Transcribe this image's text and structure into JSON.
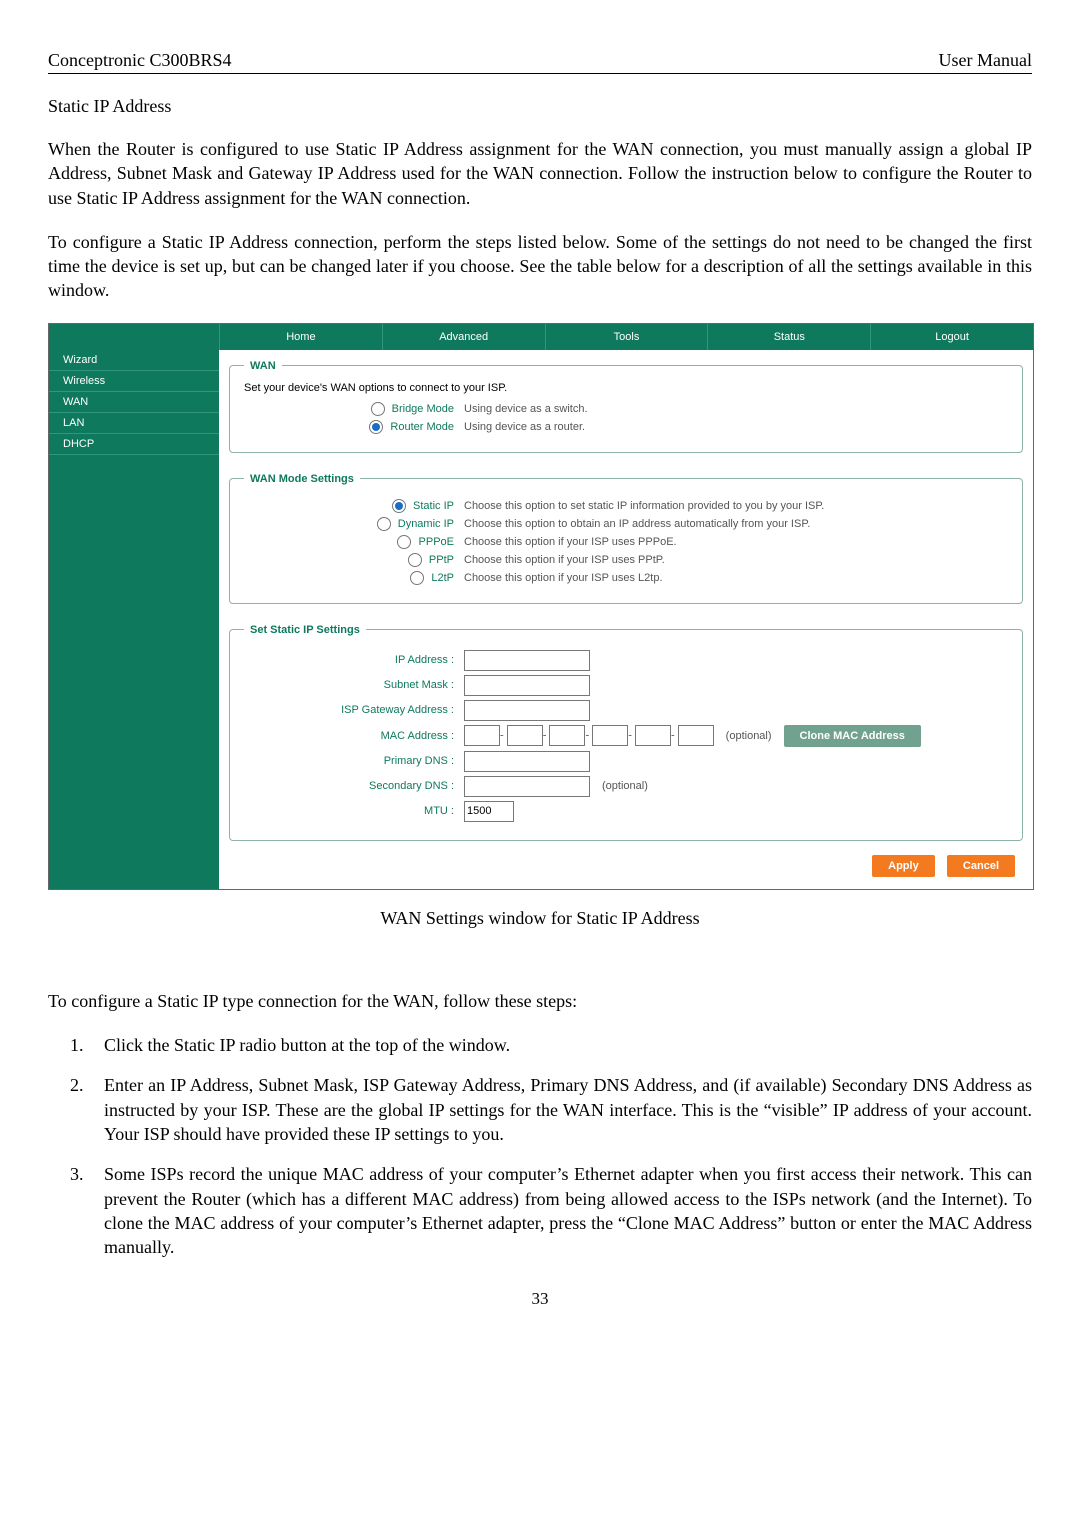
{
  "header": {
    "left": "Conceptronic C300BRS4",
    "right": "User Manual"
  },
  "title": "Static IP Address",
  "para1": "When the Router is configured to use Static IP Address assignment for the WAN connection, you must manually assign a global IP Address, Subnet Mask and Gateway IP Address used for the WAN connection. Follow the instruction below to configure the Router to use Static IP Address assignment for the WAN connection.",
  "para2": "To configure a Static IP Address connection, perform the steps listed below. Some of the settings do not need to be changed the first time the device is set up, but can be changed later if you choose. See the table below for a description of all the settings available in this window.",
  "router": {
    "topbar": {
      "home": "Home",
      "advanced": "Advanced",
      "tools": "Tools",
      "status": "Status",
      "logout": "Logout"
    },
    "sidebar": {
      "wizard": "Wizard",
      "wireless": "Wireless",
      "wan": "WAN",
      "lan": "LAN",
      "dhcp": "DHCP"
    },
    "wan_section": {
      "legend": "WAN",
      "note": "Set your device's WAN options to connect to your ISP.",
      "bridge_label": "Bridge Mode",
      "bridge_desc": "Using device as a switch.",
      "router_label": "Router Mode",
      "router_desc": "Using device as a router."
    },
    "mode_section": {
      "legend": "WAN Mode Settings",
      "static_label": "Static IP",
      "static_desc": "Choose this option to set static IP information provided to you by your ISP.",
      "dynamic_label": "Dynamic IP",
      "dynamic_desc": "Choose this option to obtain an IP address automatically from your ISP.",
      "pppoe_label": "PPPoE",
      "pppoe_desc": "Choose this option if your ISP uses PPPoE.",
      "pptp_label": "PPtP",
      "pptp_desc": "Choose this option if your ISP uses PPtP.",
      "l2tp_label": "L2tP",
      "l2tp_desc": "Choose this option if your ISP uses L2tp."
    },
    "static_section": {
      "legend": "Set Static IP Settings",
      "ip_label": "IP Address :",
      "subnet_label": "Subnet Mask :",
      "gw_label": "ISP Gateway Address :",
      "mac_label": "MAC Address :",
      "mac_optional": "(optional)",
      "clone_btn": "Clone MAC Address",
      "pdns_label": "Primary DNS :",
      "sdns_label": "Secondary DNS :",
      "sdns_optional": "(optional)",
      "mtu_label": "MTU :",
      "mtu_value": "1500"
    },
    "buttons": {
      "apply": "Apply",
      "cancel": "Cancel"
    }
  },
  "caption": "WAN Settings window for Static IP Address",
  "para3": "To configure a Static IP type connection for the WAN, follow these steps:",
  "steps": {
    "s1": "Click the Static IP radio button at the top of the window.",
    "s2": "Enter an IP Address, Subnet Mask, ISP Gateway Address, Primary DNS Address, and (if available) Secondary DNS Address as instructed by your ISP. These are the global IP settings for the WAN interface. This is the “visible” IP address of your account. Your ISP should have provided these IP settings to you.",
    "s3": "Some ISPs record the unique MAC address of your computer’s Ethernet adapter when you first access their network. This can prevent the Router (which has a different MAC address) from being allowed access to the ISPs network (and the Internet). To clone the MAC address of your computer’s Ethernet adapter, press the “Clone MAC Address” button or enter the MAC Address manually."
  },
  "page_number": "33"
}
